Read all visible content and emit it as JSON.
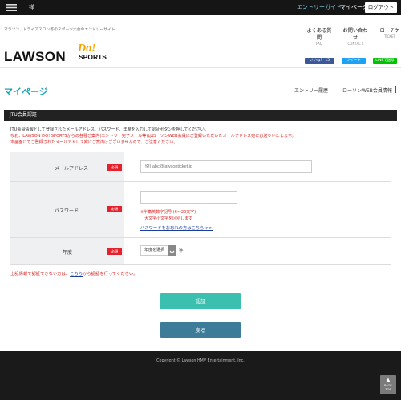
{
  "topbar": {
    "left_text": "禅",
    "entry_guide": "エントリーガイド",
    "mypage": "マイページ",
    "logout": "ログアウト"
  },
  "header": {
    "tagline": "マラソン、トライアスロン等のスポーツ大会のエントリーサイト",
    "logo": {
      "main": "LAWSON",
      "do": "Do!",
      "sports": "SPORTS"
    },
    "nav": [
      {
        "label": "よくある質問",
        "sub": "FAQ"
      },
      {
        "label": "お問い合わせ",
        "sub": "CONTACT"
      },
      {
        "label": "ローチケ",
        "sub": "TICKET"
      }
    ],
    "share": {
      "facebook": "いいね！ 15",
      "twitter": "ツイート",
      "line": "LINEで送る"
    }
  },
  "page": {
    "title": "マイページ",
    "nav": [
      "エントリー履歴",
      "ローソンWEB会員情報"
    ]
  },
  "section": {
    "title": "JTU会員認証",
    "desc": [
      "JTU会員情報として登録されたメールアドレス、パスワード、年度を入力して認証ボタンを押してください。",
      "なお、LAWSON DO! SPORTSからの各種ご案内(エントリー完了メール等)はローソンWEB会員にご登録いただいたメールアドレス宛にお送りいたします。",
      "本画面にてご登録されたメールアドレス宛にご案内はございませんので、ご注意ください。"
    ]
  },
  "form": {
    "required": "必須",
    "email": {
      "label": "メールアドレス",
      "placeholder": "例) abc@lawsonticket.jp",
      "value": ""
    },
    "password": {
      "label": "パスワード",
      "value": "",
      "note1": "※半角英数字記号 (6〜20文字)",
      "note2": "大文字小文字を区別します",
      "forgot_link": "パスワードをお忘れの方はこちら >>"
    },
    "year": {
      "label": "年度",
      "selected": "年度を選択",
      "suffix": "年"
    }
  },
  "fail_note": {
    "before": "上記情報で認証できない方は、",
    "link": "こちら",
    "after": "から認証を行ってください。"
  },
  "buttons": {
    "auth": "認証",
    "back": "戻る"
  },
  "footer": {
    "copyright": "Copyright © Lawson HMV Entertainment, Inc.",
    "pagetop_line1": "PAGE",
    "pagetop_line2": "TOP"
  },
  "colors": {
    "accent": "#19a3b5",
    "auth_button": "#3bbfae",
    "back_button": "#3d7c98",
    "required": "#e4222d",
    "facebook": "#3b5998",
    "twitter": "#1da1f2",
    "line": "#00c300"
  }
}
